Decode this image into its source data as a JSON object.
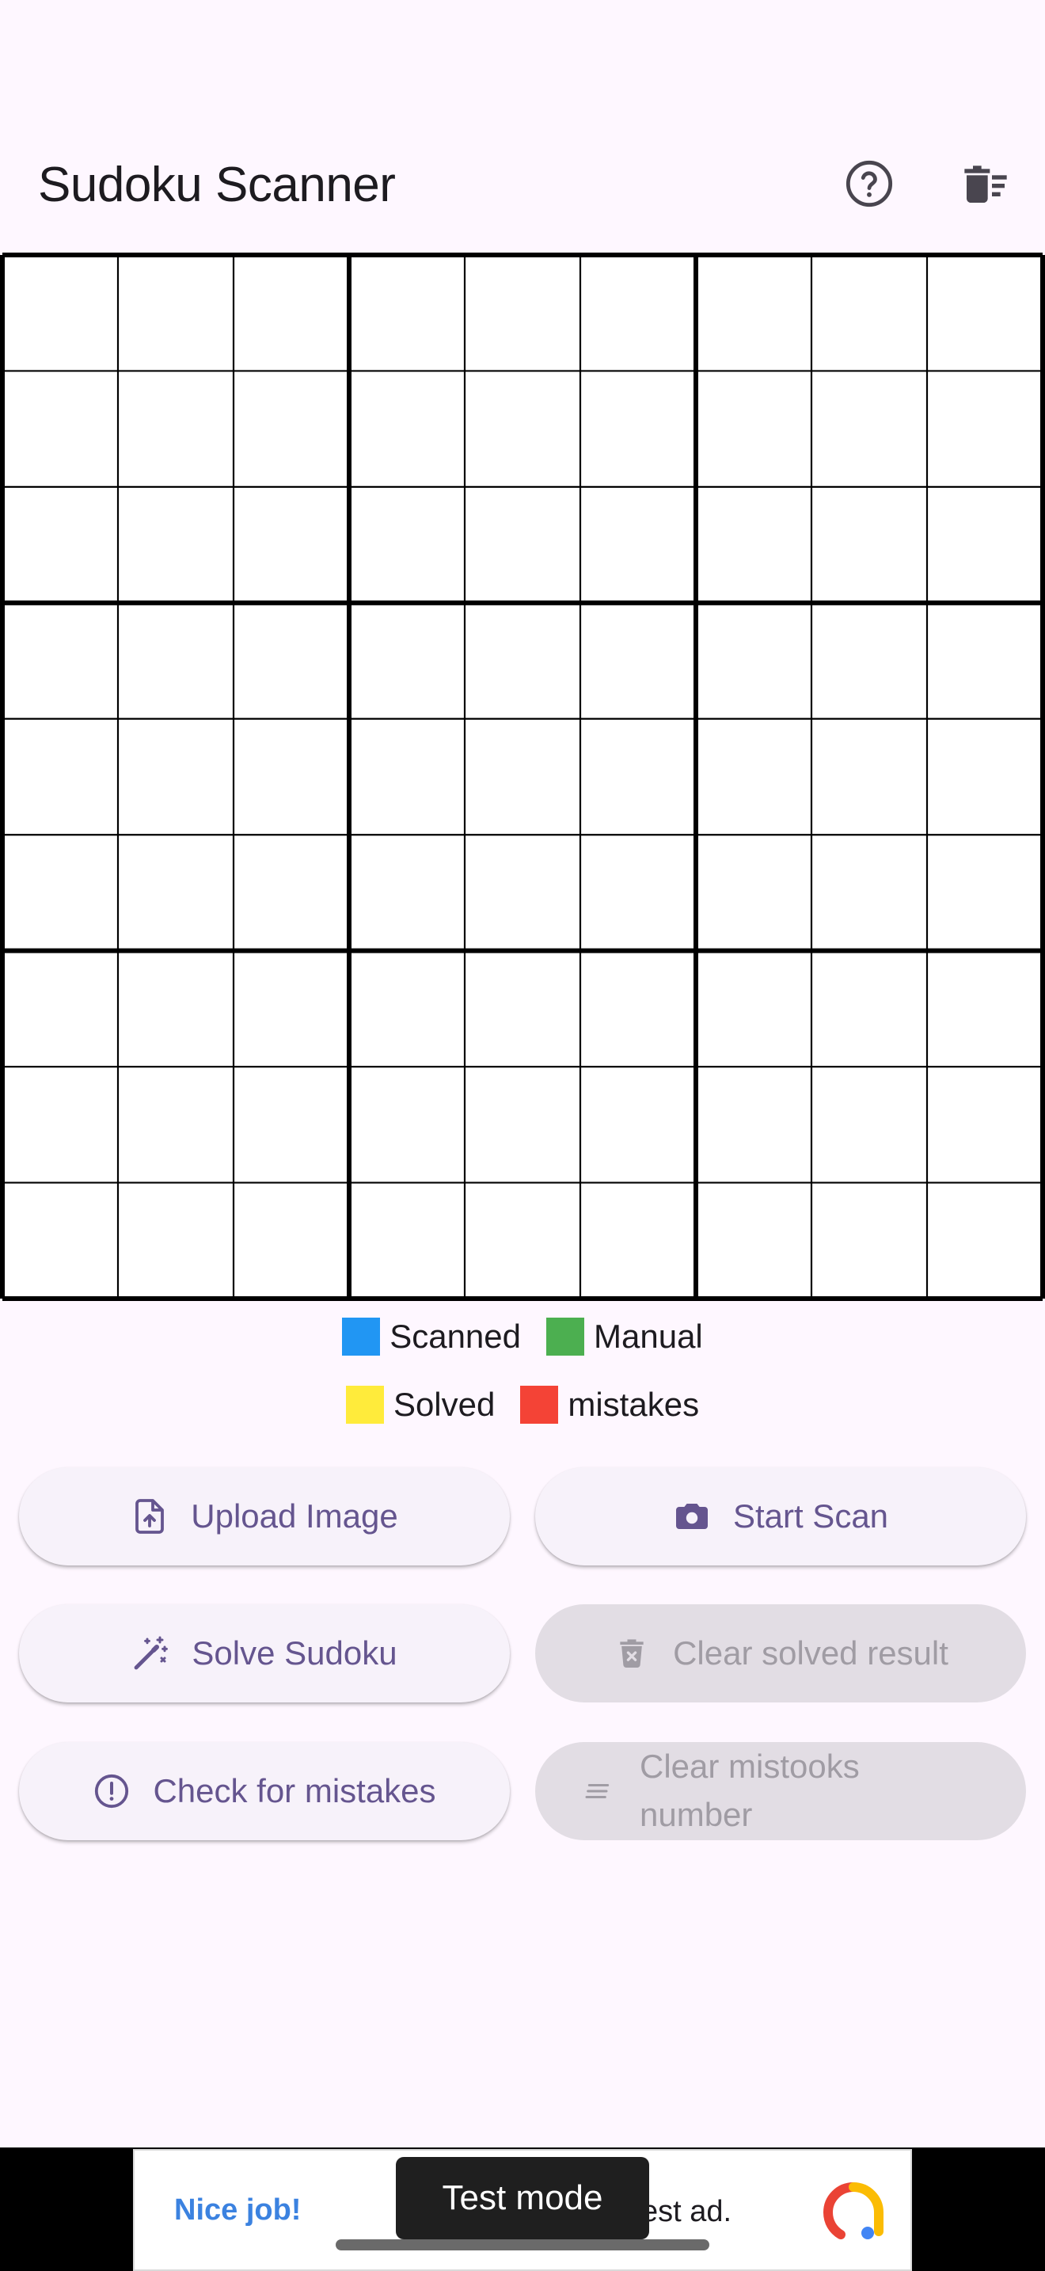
{
  "appbar": {
    "title": "Sudoku Scanner",
    "help_icon": "help-circle-icon",
    "delete_icon": "delete-sweep-icon"
  },
  "grid": {
    "size": 9,
    "cells_filled": 0
  },
  "legend": [
    {
      "label": "Scanned",
      "color": "#2196F3"
    },
    {
      "label": "Manual",
      "color": "#4CAF50"
    },
    {
      "label": "Solved",
      "color": "#FFEB3B"
    },
    {
      "label": "mistakes",
      "color": "#F44336"
    }
  ],
  "buttons": {
    "upload": {
      "label": "Upload Image",
      "icon": "upload-file-icon",
      "enabled": true
    },
    "scan": {
      "label": "Start Scan",
      "icon": "camera-icon",
      "enabled": true
    },
    "solve": {
      "label": "Solve Sudoku",
      "icon": "magic-wand-icon",
      "enabled": true
    },
    "clear_solved": {
      "label": "Clear solved result",
      "icon": "delete-icon",
      "enabled": false
    },
    "check": {
      "label": "Check for mistakes",
      "icon": "alert-circle-icon",
      "enabled": true
    },
    "clear_mistakes": {
      "label": "Clear mistooks number",
      "icon": "clear-all-icon",
      "enabled": false
    }
  },
  "ad": {
    "left_text": "Nice job!",
    "right_text": "est ad.",
    "toast": "Test mode"
  },
  "colors": {
    "background": "#FEF7FF",
    "accent": "#65558F",
    "disabled_bg": "#E2DDE4",
    "disabled_text": "#A09CA4"
  }
}
